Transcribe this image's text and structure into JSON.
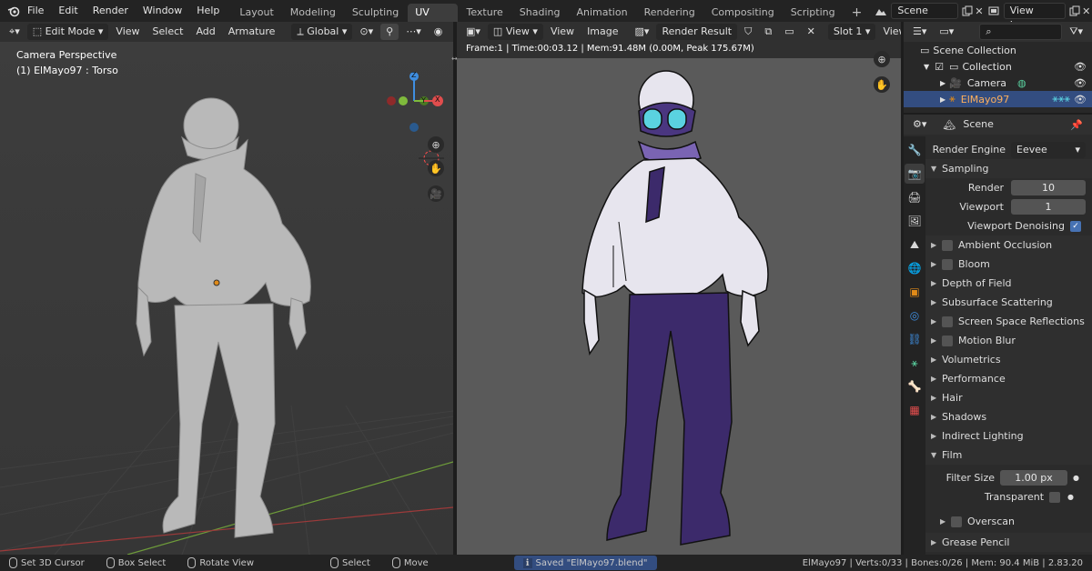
{
  "topbar": {
    "menus": [
      "File",
      "Edit",
      "Render",
      "Window",
      "Help"
    ],
    "workspaces": [
      "Layout",
      "Modeling",
      "Sculpting",
      "UV Editing",
      "Texture Paint",
      "Shading",
      "Animation",
      "Rendering",
      "Compositing",
      "Scripting"
    ],
    "active_workspace": "UV Editing",
    "add_tab": "+",
    "scene_label": "Scene",
    "view_layer_label": "View Layer"
  },
  "viewport3d": {
    "mode": "Edit Mode",
    "menus": [
      "View",
      "Select",
      "Add",
      "Armature"
    ],
    "orientation": "Global",
    "camera_label": "Camera Perspective",
    "object_label": "(1) ElMayo97 : Torso"
  },
  "image_editor": {
    "view_label": "View",
    "menus": [
      "View",
      "Image"
    ],
    "image_name": "Render Result",
    "slot": "Slot 1",
    "view_trunc": "View",
    "info": "Frame:1 | Time:00:03.12 | Mem:91.48M (0.00M, Peak 175.67M)"
  },
  "outliner": {
    "items": [
      {
        "label": "Scene Collection"
      },
      {
        "label": "Collection"
      },
      {
        "label": "Camera"
      },
      {
        "label": "ElMayo97"
      }
    ]
  },
  "properties": {
    "header": "Scene",
    "render_engine_label": "Render Engine",
    "render_engine": "Eevee",
    "sampling_label": "Sampling",
    "render_label": "Render",
    "render_value": "10",
    "viewport_label": "Viewport",
    "viewport_value": "1",
    "viewport_denoising": "Viewport Denoising",
    "panels": [
      {
        "label": "Ambient Occlusion",
        "check": true
      },
      {
        "label": "Bloom",
        "check": true
      },
      {
        "label": "Depth of Field",
        "check": false
      },
      {
        "label": "Subsurface Scattering",
        "check": false
      },
      {
        "label": "Screen Space Reflections",
        "check": true
      },
      {
        "label": "Motion Blur",
        "check": true
      },
      {
        "label": "Volumetrics",
        "check": false
      },
      {
        "label": "Performance",
        "check": false
      },
      {
        "label": "Hair",
        "check": false
      },
      {
        "label": "Shadows",
        "check": false
      },
      {
        "label": "Indirect Lighting",
        "check": false
      }
    ],
    "film_label": "Film",
    "filter_size_label": "Filter Size",
    "filter_size_value": "1.00 px",
    "transparent_label": "Transparent",
    "overscan_label": "Overscan",
    "grease_pencil_label": "Grease Pencil"
  },
  "statusbar": {
    "set_cursor": "Set 3D Cursor",
    "box_select": "Box Select",
    "rotate_view": "Rotate View",
    "select": "Select",
    "move": "Move",
    "saved_msg": "Saved \"ElMayo97.blend\"",
    "stats": "ElMayo97 | Verts:0/33 | Bones:0/26 | Mem: 90.4 MiB | 2.83.20"
  },
  "colors": {
    "accent": "#4772b3",
    "selected_row": "#334d80",
    "selected_text": "#ffb05c",
    "axis_x": "#e04d4d",
    "axis_y": "#7fba3c",
    "axis_z": "#3f8ee0",
    "suit_white": "#e7e5ee",
    "suit_purple": "#3c2a6b",
    "visor": "#5ad2e0"
  }
}
